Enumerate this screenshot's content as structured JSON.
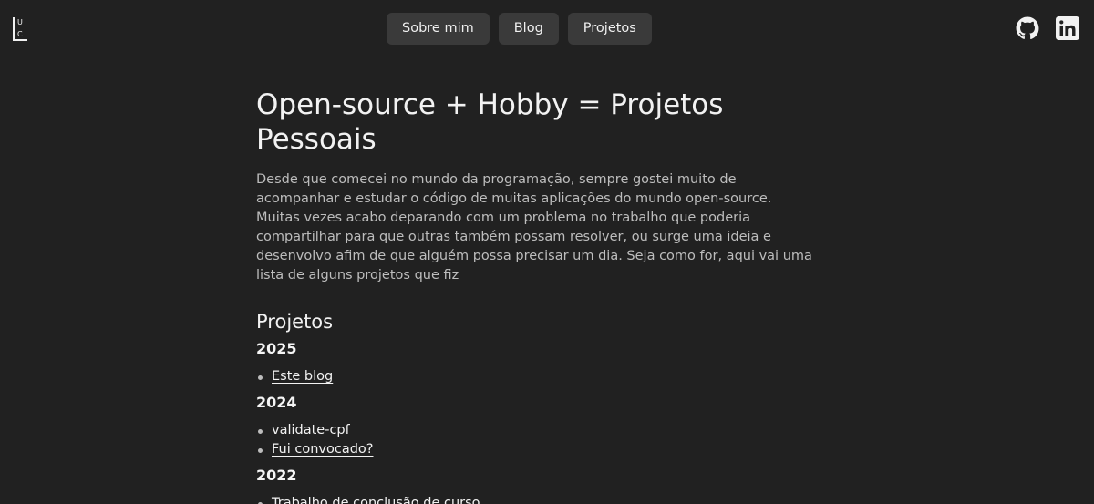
{
  "logo": {
    "letters": [
      "U",
      "L",
      "C"
    ]
  },
  "nav": {
    "items": [
      {
        "label": "Sobre mim"
      },
      {
        "label": "Blog"
      },
      {
        "label": "Projetos"
      }
    ]
  },
  "social": {
    "icons": [
      "github-icon",
      "linkedin-icon"
    ]
  },
  "main": {
    "title": "Open-source + Hobby = Projetos Pessoais",
    "intro": "Desde que comecei no mundo da programação, sempre gostei muito de acompanhar e estudar o código de muitas aplicações do mundo open-source. Muitas vezes acabo deparando com um problema no trabalho que poderia compartilhar para que outras também possam resolver, ou surge uma ideia e desenvolvo afim de que alguém possa precisar um dia. Seja como for, aqui vai uma lista de alguns projetos que fiz",
    "section_title": "Projetos",
    "years": [
      {
        "year": "2025",
        "projects": [
          "Este blog"
        ]
      },
      {
        "year": "2024",
        "projects": [
          "validate-cpf",
          "Fui convocado?"
        ]
      },
      {
        "year": "2022",
        "projects": [
          "Trabalho de conclusão de curso"
        ]
      }
    ]
  },
  "colors": {
    "background": "#212121",
    "button_bg": "#3a3a3a",
    "text": "#ececec",
    "muted_text": "#bdbdbd"
  }
}
